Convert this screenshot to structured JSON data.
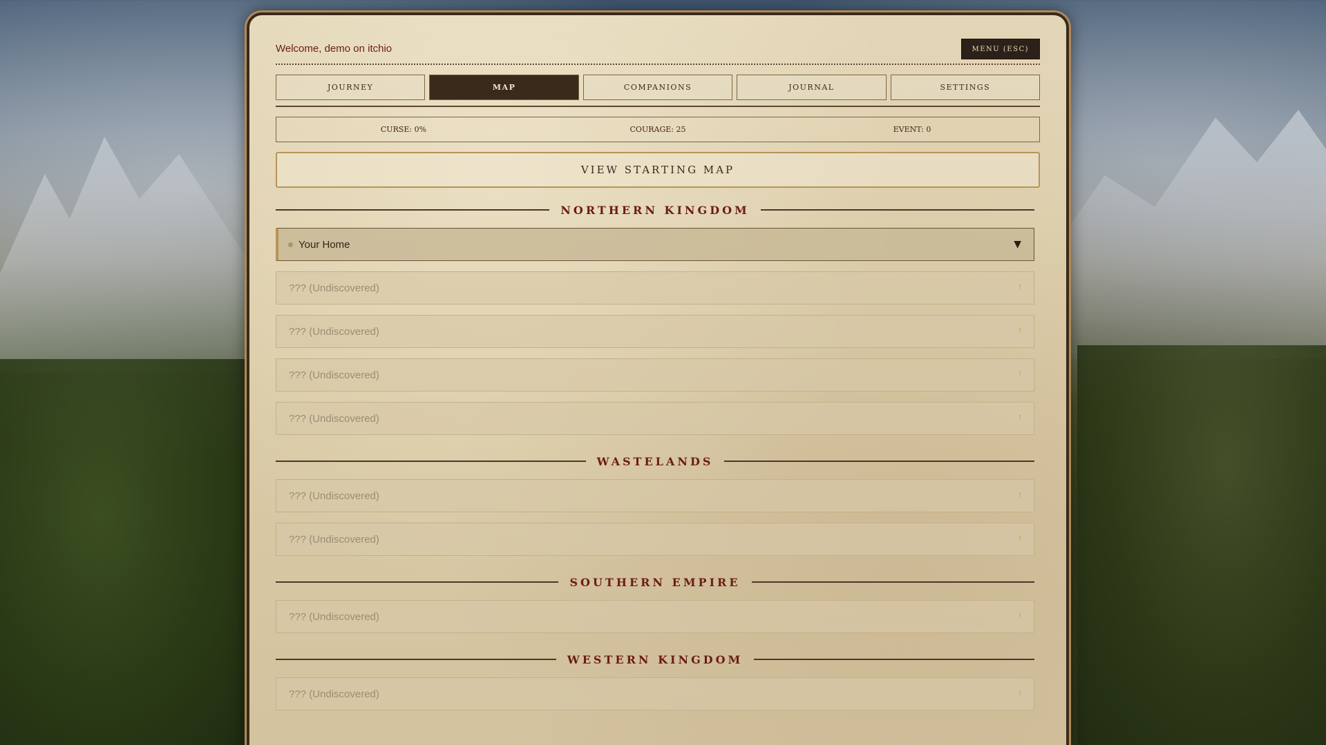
{
  "header": {
    "welcome": "Welcome, demo on itchio",
    "menu_label": "MENU (ESC)"
  },
  "tabs": [
    {
      "label": "JOURNEY",
      "active": false
    },
    {
      "label": "MAP",
      "active": true
    },
    {
      "label": "COMPANIONS",
      "active": false
    },
    {
      "label": "JOURNAL",
      "active": false
    },
    {
      "label": "SETTINGS",
      "active": false
    }
  ],
  "stats": {
    "curse": "CURSE: 0%",
    "courage": "COURAGE: 25",
    "event": "EVENT: 0"
  },
  "start_map_label": "VIEW STARTING MAP",
  "regions": [
    {
      "title": "NORTHERN KINGDOM",
      "locations": [
        {
          "name": "Your Home",
          "discovered": true,
          "indicator": "▼"
        },
        {
          "name": "??? (Undiscovered)",
          "discovered": false,
          "indicator": "!"
        },
        {
          "name": "??? (Undiscovered)",
          "discovered": false,
          "indicator": "!"
        },
        {
          "name": "??? (Undiscovered)",
          "discovered": false,
          "indicator": "!"
        },
        {
          "name": "??? (Undiscovered)",
          "discovered": false,
          "indicator": "!"
        }
      ]
    },
    {
      "title": "WASTELANDS",
      "locations": [
        {
          "name": "??? (Undiscovered)",
          "discovered": false,
          "indicator": "!"
        },
        {
          "name": "??? (Undiscovered)",
          "discovered": false,
          "indicator": "!"
        }
      ]
    },
    {
      "title": "SOUTHERN EMPIRE",
      "locations": [
        {
          "name": "??? (Undiscovered)",
          "discovered": false,
          "indicator": "!"
        }
      ]
    },
    {
      "title": "WESTERN KINGDOM",
      "locations": [
        {
          "name": "??? (Undiscovered)",
          "discovered": false,
          "indicator": "!"
        }
      ]
    }
  ],
  "colors": {
    "accent_dark": "#3a2a1c",
    "title_red": "#6b1c14",
    "parchment": "#dacaa6",
    "undiscovered_marker": "#d38b2c"
  }
}
